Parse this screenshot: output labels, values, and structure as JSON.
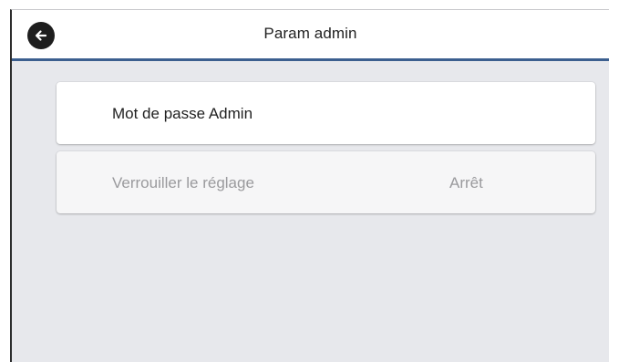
{
  "header": {
    "title": "Param admin",
    "back_icon": "arrow-left-icon"
  },
  "menu": {
    "items": [
      {
        "label": "Mot de passe Admin",
        "value": "",
        "enabled": true
      },
      {
        "label": "Verrouiller le réglage",
        "value": "Arrêt",
        "enabled": false
      }
    ]
  },
  "colors": {
    "header_accent": "#3c5f8f",
    "background": "#e7e8ec",
    "back_button": "#1e1e1e",
    "disabled_text": "#9a9a9d"
  }
}
